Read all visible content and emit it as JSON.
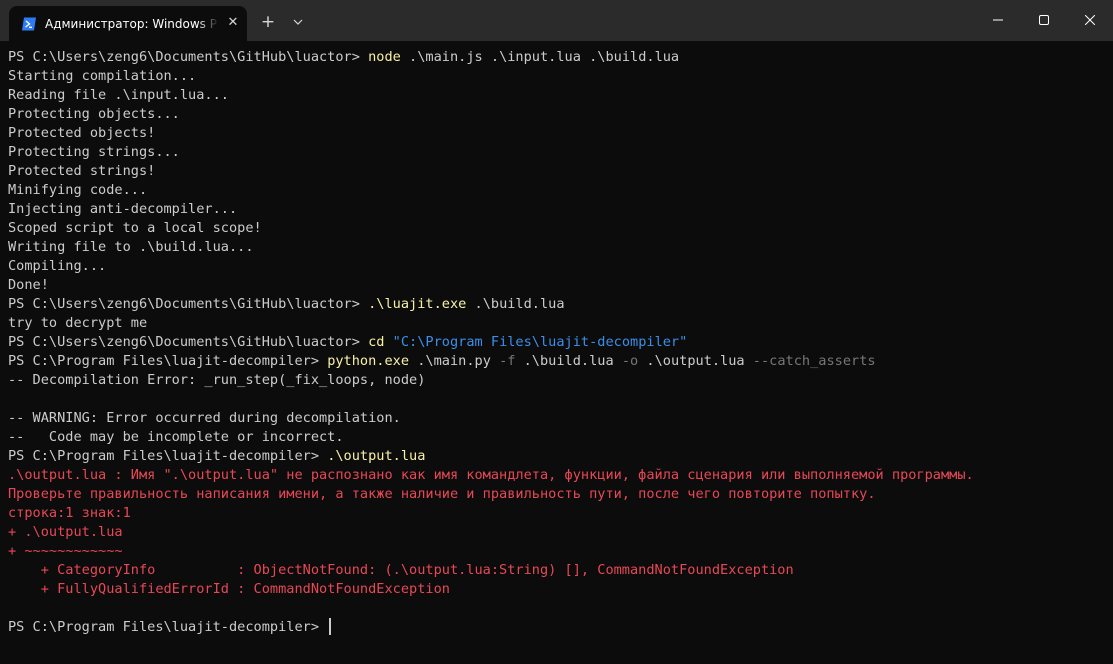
{
  "window": {
    "tab_title": "Администратор: Windows PowerShell",
    "tab_close_glyph": "✕",
    "new_tab_glyph": "+",
    "icons": {
      "tab_icon": "powershell-icon",
      "dropdown": "chevron-down-icon",
      "minimize": "minimize-icon",
      "maximize": "maximize-icon",
      "close": "close-icon"
    }
  },
  "colors": {
    "background": "#0c0c0c",
    "titlebar": "#2b2b2b",
    "text": "#cccccc",
    "command": "#f9f1a5",
    "string": "#3b8eea",
    "parameter": "#767676",
    "error": "#e74856"
  },
  "terminal": {
    "lines": [
      {
        "type": "prompt",
        "prompt": "PS C:\\Users\\zeng6\\Documents\\GitHub\\luactor> ",
        "cmd": "node",
        "rest": " .\\main.js .\\input.lua .\\build.lua"
      },
      {
        "type": "out",
        "text": "Starting compilation..."
      },
      {
        "type": "out",
        "text": "Reading file .\\input.lua..."
      },
      {
        "type": "out",
        "text": "Protecting objects..."
      },
      {
        "type": "out",
        "text": "Protected objects!"
      },
      {
        "type": "out",
        "text": "Protecting strings..."
      },
      {
        "type": "out",
        "text": "Protected strings!"
      },
      {
        "type": "out",
        "text": "Minifying code..."
      },
      {
        "type": "out",
        "text": "Injecting anti-decompiler..."
      },
      {
        "type": "out",
        "text": "Scoped script to a local scope!"
      },
      {
        "type": "out",
        "text": "Writing file to .\\build.lua..."
      },
      {
        "type": "out",
        "text": "Compiling..."
      },
      {
        "type": "out",
        "text": "Done!"
      },
      {
        "type": "prompt",
        "prompt": "PS C:\\Users\\zeng6\\Documents\\GitHub\\luactor> ",
        "cmd": ".\\luajit.exe",
        "rest": " .\\build.lua"
      },
      {
        "type": "out",
        "text": "try to decrypt me"
      },
      {
        "type": "prompt",
        "prompt": "PS C:\\Users\\zeng6\\Documents\\GitHub\\luactor> ",
        "cmd": "cd",
        "rest": " ",
        "str": "\"C:\\Program Files\\luajit-decompiler\""
      },
      {
        "type": "python",
        "prompt": "PS C:\\Program Files\\luajit-decompiler> ",
        "cmd": "python.exe",
        "a": " .\\main.py ",
        "p1": "-f",
        "b": " .\\build.lua ",
        "p2": "-o",
        "c": " .\\output.lua ",
        "p3": "--catch_asserts"
      },
      {
        "type": "out",
        "text": "-- Decompilation Error: _run_step(_fix_loops, node)"
      },
      {
        "type": "out",
        "text": ""
      },
      {
        "type": "out",
        "text": "-- WARNING: Error occurred during decompilation."
      },
      {
        "type": "out",
        "text": "--   Code may be incomplete or incorrect."
      },
      {
        "type": "prompt",
        "prompt": "PS C:\\Program Files\\luajit-decompiler> ",
        "cmd": ".\\output.lua",
        "rest": ""
      },
      {
        "type": "err",
        "text": ".\\output.lua : Имя \".\\output.lua\" не распознано как имя командлета, функции, файла сценария или выполняемой программы."
      },
      {
        "type": "err",
        "text": "Проверьте правильность написания имени, а также наличие и правильность пути, после чего повторите попытку."
      },
      {
        "type": "err",
        "text": "строка:1 знак:1"
      },
      {
        "type": "err",
        "text": "+ .\\output.lua"
      },
      {
        "type": "err",
        "text": "+ ~~~~~~~~~~~~"
      },
      {
        "type": "err",
        "text": "    + CategoryInfo          : ObjectNotFound: (.\\output.lua:String) [], CommandNotFoundException"
      },
      {
        "type": "err",
        "text": "    + FullyQualifiedErrorId : CommandNotFoundException"
      },
      {
        "type": "out",
        "text": ""
      },
      {
        "type": "current",
        "prompt": "PS C:\\Program Files\\luajit-decompiler> "
      }
    ]
  }
}
